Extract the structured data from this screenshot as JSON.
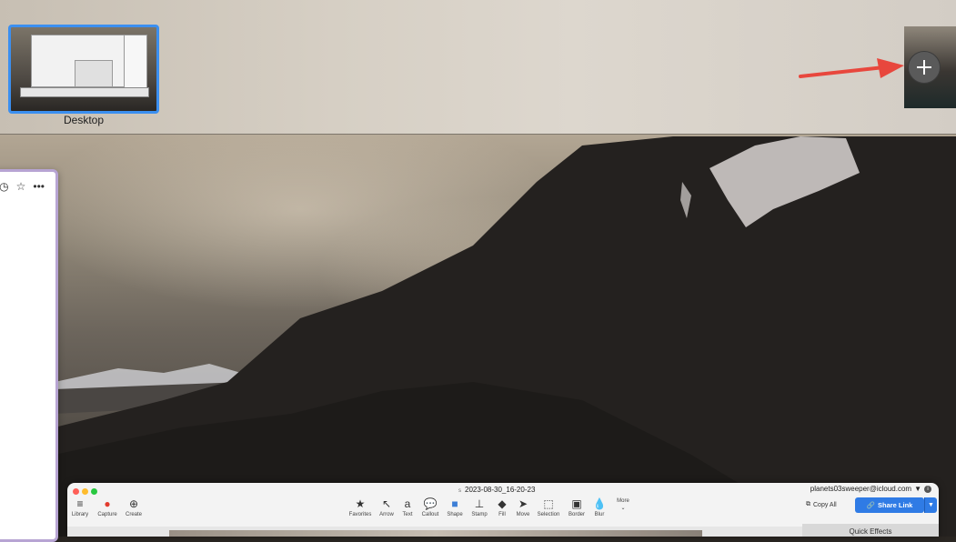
{
  "spaces": {
    "desktop_label": "Desktop"
  },
  "left_window": {
    "icons": [
      "clock-icon",
      "star-icon",
      "more-icon"
    ],
    "star_glyph": "☆",
    "more_glyph": "•••",
    "clock_glyph": "◷"
  },
  "app": {
    "document_title": "2023-08-30_16-20-23",
    "account_email": "planets03sweeper@icloud.com",
    "left_tools": [
      {
        "label": "Library",
        "glyph": "≡"
      },
      {
        "label": "Capture",
        "glyph": "●"
      },
      {
        "label": "Create",
        "glyph": "⊕"
      }
    ],
    "tools": [
      {
        "label": "Favorites",
        "glyph": "★"
      },
      {
        "label": "Arrow",
        "glyph": "↖"
      },
      {
        "label": "Text",
        "glyph": "a"
      },
      {
        "label": "Callout",
        "glyph": "💬"
      },
      {
        "label": "Shape",
        "glyph": "■"
      },
      {
        "label": "Stamp",
        "glyph": "⊥"
      },
      {
        "label": "Fill",
        "glyph": "◆"
      },
      {
        "label": "Move",
        "glyph": "➤"
      },
      {
        "label": "Selection",
        "glyph": "⬚"
      },
      {
        "label": "Border",
        "glyph": "▣"
      },
      {
        "label": "Blur",
        "glyph": "💧"
      }
    ],
    "more_label": "More",
    "copy_all_label": "Copy All",
    "share_link_label": "Share Link",
    "quick_effects_label": "Quick Effects",
    "capture_color": "#e23b2e",
    "accent_color": "#2f7be5"
  }
}
